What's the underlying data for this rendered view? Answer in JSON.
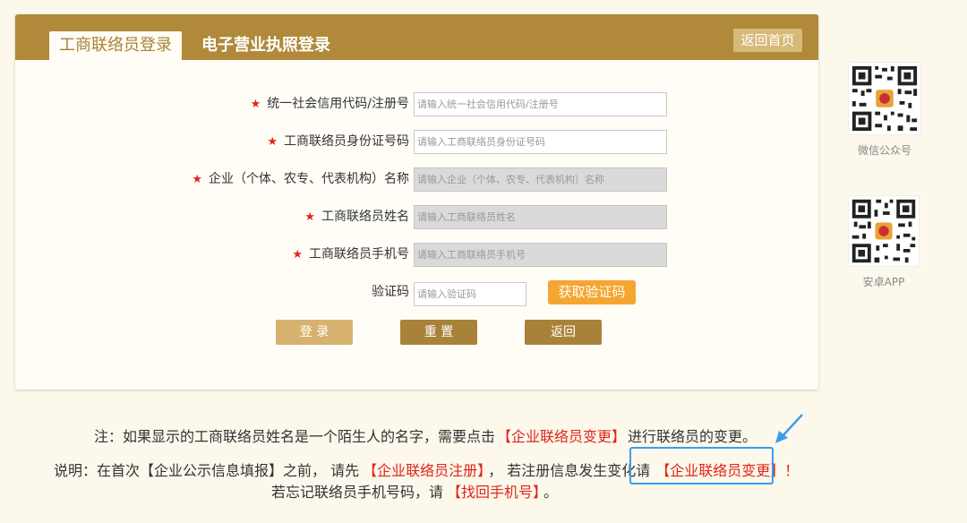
{
  "header": {
    "tab_active": "工商联络员登录",
    "tab_2": "电子营业执照登录",
    "home_button": "返回首页"
  },
  "form": {
    "fields": [
      {
        "label": "统一社会信用代码/注册号",
        "placeholder": "请输入统一社会信用代码/注册号",
        "required": true,
        "readonly": false
      },
      {
        "label": "工商联络员身份证号码",
        "placeholder": "请输入工商联络员身份证号码",
        "required": true,
        "readonly": false
      },
      {
        "label": "企业（个体、农专、代表机构）名称",
        "placeholder": "请输入企业（个体、农专、代表机构）名称",
        "required": true,
        "readonly": true
      },
      {
        "label": "工商联络员姓名",
        "placeholder": "请输入工商联络员姓名",
        "required": true,
        "readonly": true
      },
      {
        "label": "工商联络员手机号",
        "placeholder": "请输入工商联络员手机号",
        "required": true,
        "readonly": true
      }
    ],
    "captcha": {
      "label": "验证码",
      "placeholder": "请输入验证码",
      "button": "获取验证码"
    },
    "buttons": {
      "login": "登 录",
      "reset": "重 置",
      "back": "返回"
    }
  },
  "notes": {
    "line1_pre": "注：如果显示的工商联络员姓名是一个陌生人的名字，需要点击",
    "line1_link": "【企业联络员变更】",
    "line1_post": "进行联络员的变更。",
    "line2_pre": "说明：在首次【企业公示信息填报】之前， 请先",
    "line2_link1": "【企业联络员注册】",
    "line2_mid": "， 若注册信息发生变化请",
    "line2_link2": "【企业联络员变更】！",
    "line3_pre": "若忘记联络员手机号码，请",
    "line3_link": "【找回手机号】",
    "line3_post": "。"
  },
  "sidebar": {
    "qr1_caption": "微信公众号",
    "qr2_caption": "安卓APP"
  },
  "colors": {
    "brand": "#b0893a",
    "accent": "#f5a630",
    "red": "#e0251b",
    "highlight": "#3c9ded"
  }
}
